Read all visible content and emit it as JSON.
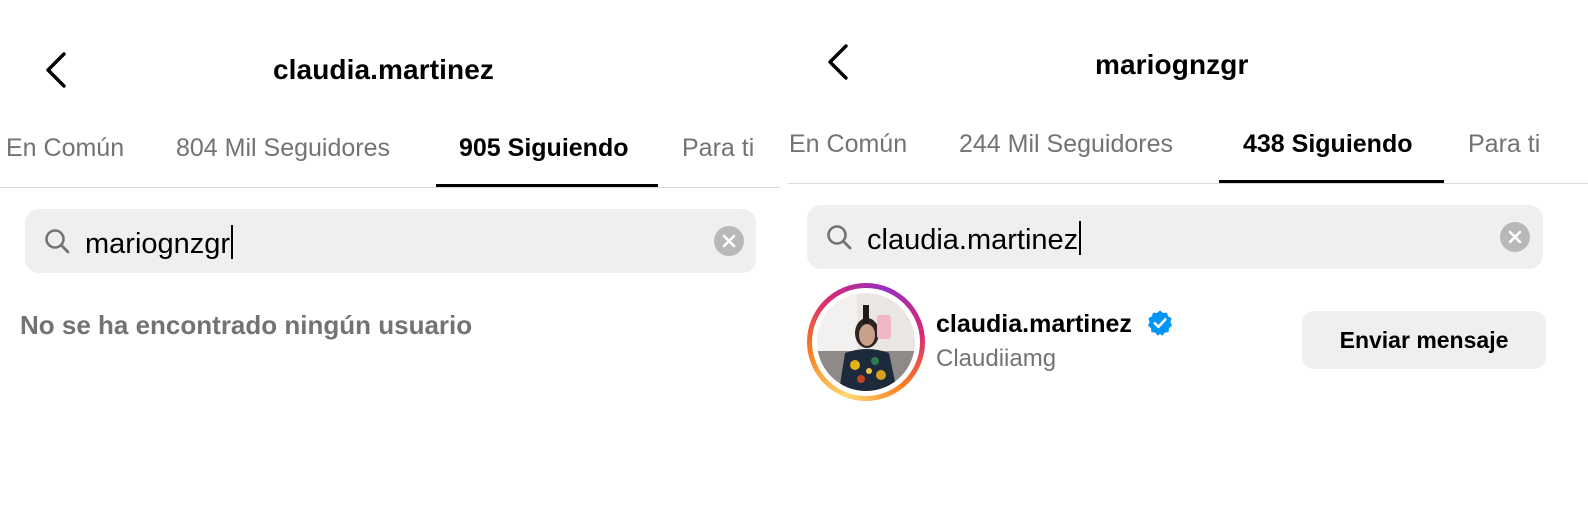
{
  "left": {
    "title": "claudia.martinez",
    "tabs": [
      {
        "label": "En Común"
      },
      {
        "label": "804 Mil Seguidores"
      },
      {
        "label": "905 Siguiendo"
      },
      {
        "label": "Para ti"
      }
    ],
    "active_tab": "905 Siguiendo",
    "search": {
      "value": "mariognzgr"
    },
    "empty_message": "No se ha encontrado ningún usuario"
  },
  "right": {
    "title": "mariognzgr",
    "tabs": [
      {
        "label": "En Común"
      },
      {
        "label": "244 Mil Seguidores"
      },
      {
        "label": "438 Siguiendo"
      },
      {
        "label": "Para ti"
      }
    ],
    "active_tab": "438 Siguiendo",
    "search": {
      "value": "claudia.martinez"
    },
    "result": {
      "username": "claudia.martinez",
      "full_name": "Claudiiamg",
      "verified": true,
      "button_label": "Enviar mensaje"
    }
  },
  "colors": {
    "secondary_text": "#737373",
    "search_bg": "#efefef",
    "verified_blue": "#0095f6",
    "divider": "#dbdbdb"
  },
  "icons": {
    "back": "chevron-left-icon",
    "search": "search-icon",
    "clear": "clear-circle-icon",
    "verified": "verified-badge-icon"
  }
}
